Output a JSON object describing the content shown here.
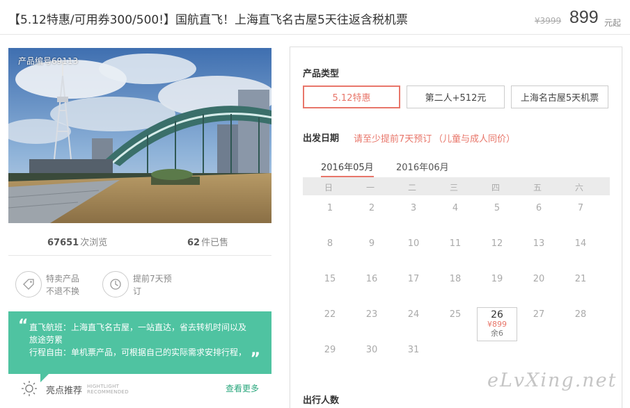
{
  "header": {
    "title": "【5.12特惠/可用券300/500!】国航直飞！上海直飞名古屋5天往返含税机票",
    "original_price": "¥3999",
    "price": "899",
    "price_unit": "元起"
  },
  "photo": {
    "product_no": "产品编号69113"
  },
  "stats": {
    "views_count": "67651",
    "views_label": "次浏览",
    "sold_count": "62",
    "sold_label": "件已售"
  },
  "features": [
    {
      "icon": "tag-icon",
      "line1": "特卖产品",
      "line2": "不退不换"
    },
    {
      "icon": "clock-icon",
      "line1": "提前7天预",
      "line2": "订"
    }
  ],
  "quote": {
    "line1": "直飞航班：上海直飞名古屋，一站直达，省去转机时间以及",
    "line2": "旅途劳累",
    "line3": "行程自由：单机票产品，可根据自己的实际需求安排行程，"
  },
  "recommend": {
    "label": "亮点推荐",
    "sub1": "HIGHTLIGHT",
    "sub2": "RECOMMENDED",
    "more": "查看更多"
  },
  "panel": {
    "product_type_label": "产品类型",
    "types": [
      "5.12特惠",
      "第二人+512元",
      "上海名古屋5天机票"
    ],
    "date_label": "出发日期",
    "hint1": "请至少提前7天预订",
    "hint2": "（儿童与成人同价）",
    "months": [
      "2016年05月",
      "2016年06月"
    ],
    "weekdays": [
      "日",
      "一",
      "二",
      "三",
      "四",
      "五",
      "六"
    ],
    "days": [
      "1",
      "2",
      "3",
      "4",
      "5",
      "6",
      "7",
      "8",
      "9",
      "10",
      "11",
      "12",
      "13",
      "14",
      "15",
      "16",
      "17",
      "18",
      "19",
      "20",
      "21",
      "22",
      "23",
      "24",
      "25",
      "26",
      "27",
      "28",
      "29",
      "30",
      "31"
    ],
    "selected_day": {
      "day": "26",
      "price": "¥899",
      "remaining": "余6"
    },
    "travelers_label": "出行人数"
  },
  "watermark": "eLvXing.net",
  "colors": {
    "accent": "#e8766a",
    "green": "#4fc3a1",
    "link": "#2aa77d"
  }
}
